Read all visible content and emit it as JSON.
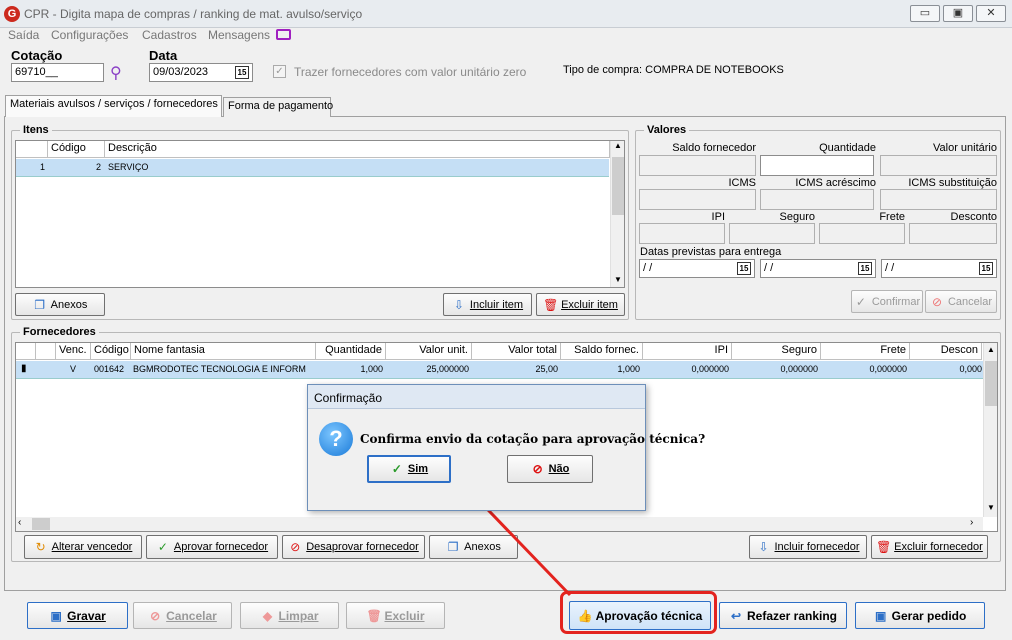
{
  "window": {
    "title": "CPR - Digita mapa de compras / ranking de mat. avulso/serviço",
    "icon": "G",
    "controls": {
      "minimize": "▭",
      "restore": "▣",
      "close": "✕"
    }
  },
  "menu": [
    "Saída",
    "Configurações",
    "Cadastros",
    "Mensagens"
  ],
  "header": {
    "cotacao_label": "Cotação",
    "cotacao_value": "69710__",
    "data_label": "Data",
    "data_value": "09/03/2023",
    "trazer_label": "Trazer fornecedores com valor unitário zero",
    "tipo_compra": "Tipo de compra: COMPRA DE NOTEBOOKS"
  },
  "tabs": [
    "Materiais avulsos / serviços / fornecedores",
    "Forma de pagamento"
  ],
  "itens": {
    "title": "Itens",
    "columns": [
      "Código",
      "Descrição"
    ],
    "rows": [
      {
        "seq": "1",
        "codigo": "2",
        "descricao": "SERVIÇO"
      }
    ],
    "anexos_label": "Anexos",
    "incluir_label": "Incluir item",
    "excluir_label": "Excluir item"
  },
  "valores": {
    "title": "Valores",
    "labels": [
      "Saldo fornecedor",
      "Quantidade",
      "Valor unitário",
      "ICMS",
      "ICMS acréscimo",
      "ICMS substituição",
      "IPI",
      "Seguro",
      "Frete",
      "Desconto"
    ],
    "datas_label": "Datas previstas para entrega",
    "date_placeholder": " / /",
    "confirmar_label": "Confirmar",
    "cancelar_label": "Cancelar"
  },
  "fornecedores": {
    "title": "Fornecedores",
    "columns": [
      "Venc.",
      "Código",
      "Nome fantasia",
      "Quantidade",
      "Valor unit.",
      "Valor total",
      "Saldo fornec.",
      "IPI",
      "Seguro",
      "Frete",
      "Descon"
    ],
    "rows": [
      {
        "venc": "V",
        "codigo": "001642",
        "nome": "BGMRODOTEC TECNOLOGIA E INFORM",
        "quantidade": "1,000",
        "valor_unit": "25,000000",
        "valor_total": "25,00",
        "saldo": "1,000",
        "ipi": "0,000000",
        "seguro": "0,000000",
        "frete": "0,000000",
        "desconto": "0,000"
      }
    ],
    "alterar_label": "Alterar vencedor",
    "aprovar_label": "Aprovar fornecedor",
    "desaprovar_label": "Desaprovar fornecedor",
    "anexos_label": "Anexos",
    "incluir_label": "Incluir fornecedor",
    "excluir_label": "Excluir fornecedor"
  },
  "bottom": {
    "gravar": "Gravar",
    "cancelar": "Cancelar",
    "limpar": "Limpar",
    "excluir": "Excluir",
    "aprovacao": "Aprovação técnica",
    "refazer": "Refazer ranking",
    "gerar": "Gerar pedido"
  },
  "dialog": {
    "title": "Confirmação",
    "message": "Confirma envio da cotação para aprovação técnica?",
    "sim": "Sim",
    "nao": "Não"
  },
  "colors": {
    "accent": "#2d6fc7",
    "highlight": "#e3231e",
    "selection": "#c5dff5"
  }
}
